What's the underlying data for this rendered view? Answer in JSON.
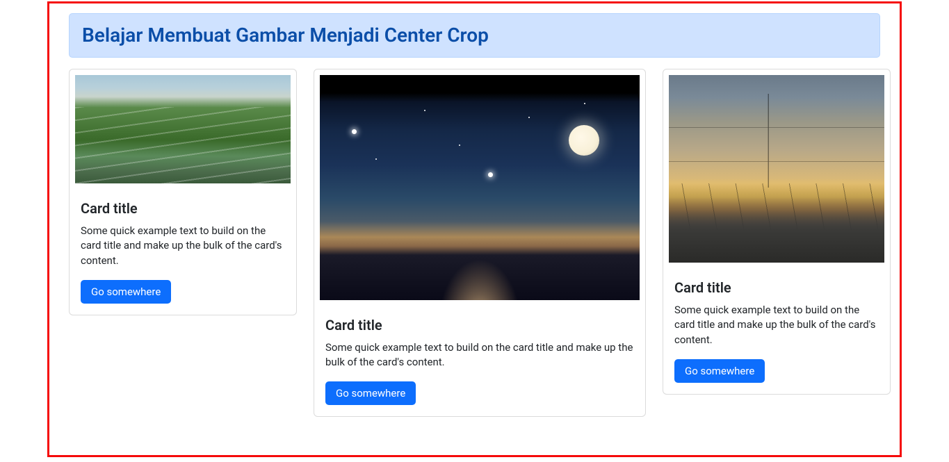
{
  "header": {
    "title": "Belajar Membuat Gambar Menjadi Center Crop"
  },
  "cards": [
    {
      "title": "Card title",
      "text": "Some quick example text to build on the card title and make up the bulk of the card's content.",
      "button": "Go somewhere"
    },
    {
      "title": "Card title",
      "text": "Some quick example text to build on the card title and make up the bulk of the card's content.",
      "button": "Go somewhere"
    },
    {
      "title": "Card title",
      "text": "Some quick example text to build on the card title and make up the bulk of the card's content.",
      "button": "Go somewhere"
    }
  ],
  "colors": {
    "alert_bg": "#cfe2ff",
    "alert_border": "#b6d4fe",
    "alert_text": "#084298",
    "primary": "#0d6efd",
    "frame_border": "#f50a0a"
  }
}
